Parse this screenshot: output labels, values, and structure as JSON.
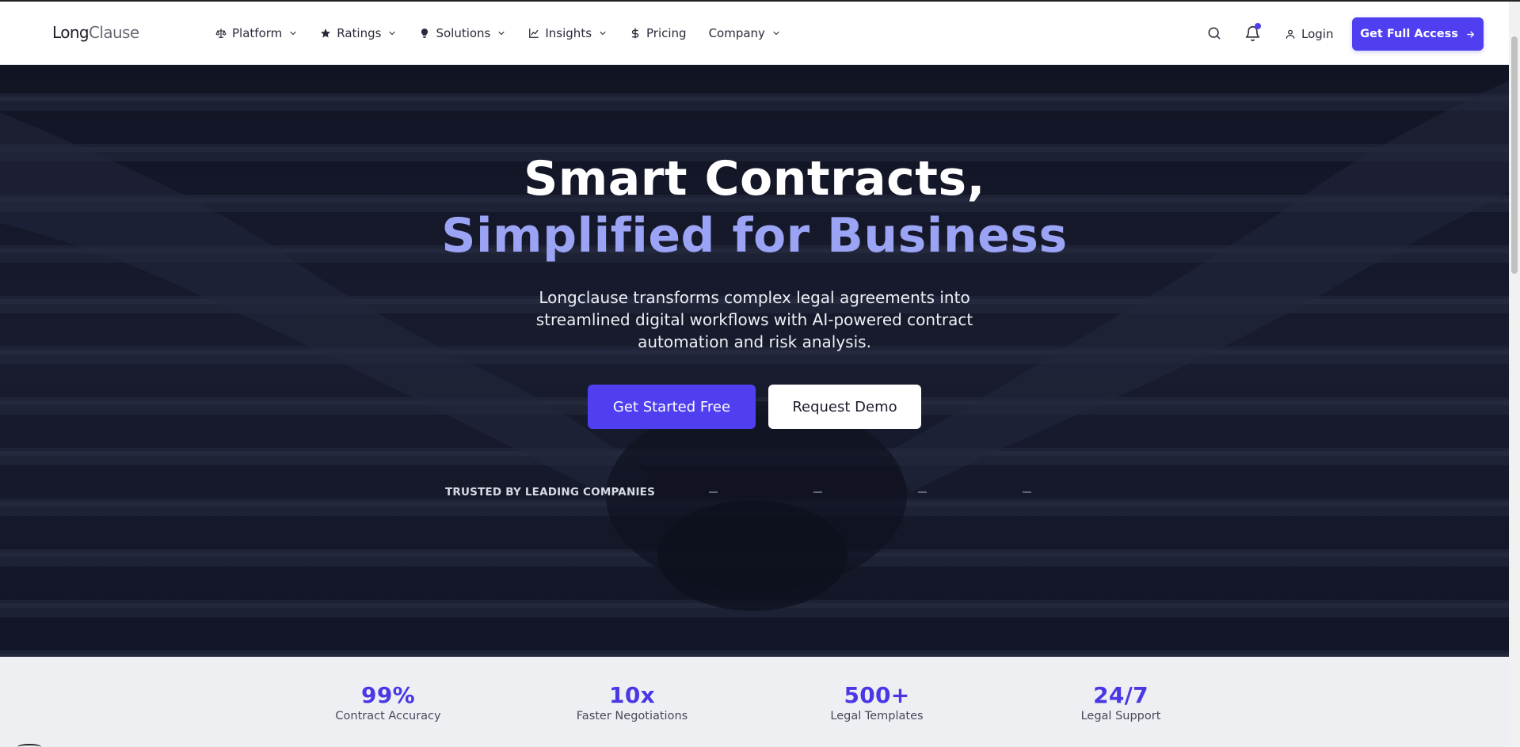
{
  "brand": {
    "name_part1": "Long",
    "name_part2": "Clause",
    "accent": "#4f3ff0",
    "heading_accent": "#9aa3f4"
  },
  "nav": {
    "items": [
      {
        "label": "Platform",
        "icon": "scale-icon",
        "has_dropdown": true
      },
      {
        "label": "Ratings",
        "icon": "star-icon",
        "has_dropdown": true
      },
      {
        "label": "Solutions",
        "icon": "lightbulb-icon",
        "has_dropdown": true
      },
      {
        "label": "Insights",
        "icon": "line-chart-icon",
        "has_dropdown": true
      },
      {
        "label": "Pricing",
        "icon": "dollar-icon",
        "has_dropdown": false
      },
      {
        "label": "Company",
        "icon": null,
        "has_dropdown": true
      }
    ],
    "login_label": "Login",
    "cta_label": "Get Full Access"
  },
  "hero": {
    "title_line1": "Smart Contracts,",
    "title_line2": "Simplified for Business",
    "subtitle": "Longclause transforms complex legal agreements into streamlined digital workflows with AI-powered contract automation and risk analysis.",
    "primary_cta": "Get Started Free",
    "secondary_cta": "Request Demo",
    "trusted_label": "TRUSTED BY LEADING COMPANIES"
  },
  "stats": [
    {
      "value": "99%",
      "label": "Contract Accuracy"
    },
    {
      "value": "10x",
      "label": "Faster Negotiations"
    },
    {
      "value": "500+",
      "label": "Legal Templates"
    },
    {
      "value": "24/7",
      "label": "Legal Support"
    }
  ]
}
